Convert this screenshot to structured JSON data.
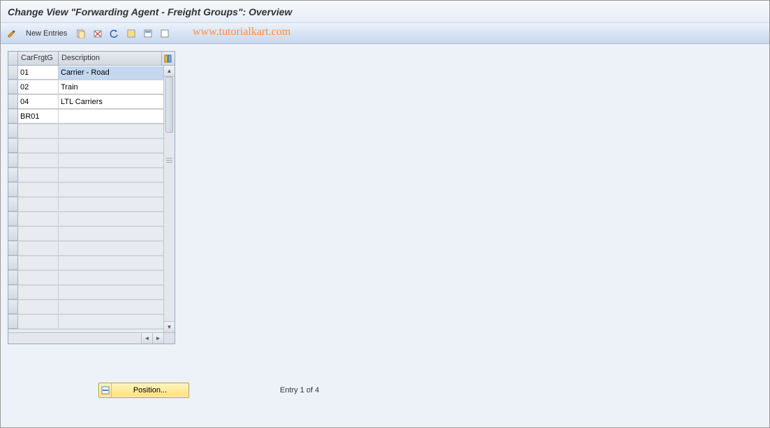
{
  "header": {
    "title": "Change View \"Forwarding Agent - Freight Groups\": Overview"
  },
  "toolbar": {
    "new_entries_label": "New Entries",
    "watermark": "www.tutorialkart.com"
  },
  "table": {
    "columns": {
      "code": "CarFrgtG",
      "desc": "Description"
    },
    "rows": [
      {
        "code": "01",
        "desc": "Carrier - Road",
        "selected": true
      },
      {
        "code": "02",
        "desc": "Train"
      },
      {
        "code": "04",
        "desc": "LTL Carriers"
      },
      {
        "code": "BR01",
        "desc": ""
      }
    ],
    "empty_row_count": 14
  },
  "footer": {
    "position_label": "Position...",
    "entry_text": "Entry 1 of 4"
  }
}
